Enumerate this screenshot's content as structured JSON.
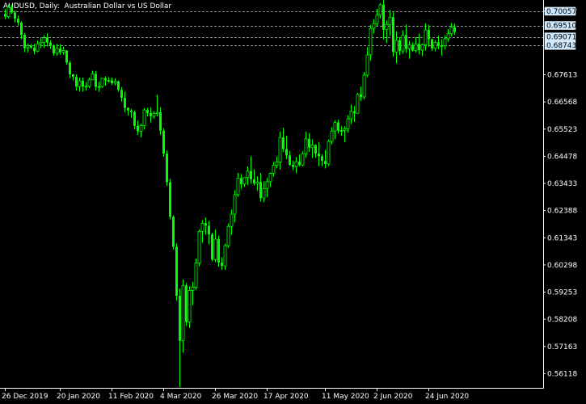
{
  "chart_data": {
    "type": "candlestick",
    "symbol": "AUDUSD",
    "timeframe": "Daily",
    "description": "Australian Dollar vs US Dollar",
    "title_sep": ", ",
    "title_sep2": ":  ",
    "ylim": [
      0.5557,
      0.7049
    ],
    "y_ticks": [
      "0.70057",
      "0.67613",
      "0.66568",
      "0.65523",
      "0.64478",
      "0.63433",
      "0.62388",
      "0.61343",
      "0.60298",
      "0.59253",
      "0.58208",
      "0.57163",
      "0.56118"
    ],
    "y_tick_values": [
      0.70057,
      0.67613,
      0.66568,
      0.65523,
      0.64478,
      0.63433,
      0.62388,
      0.61343,
      0.60298,
      0.59253,
      0.58208,
      0.57163,
      0.56118
    ],
    "highlight_labels": [
      "0.70057",
      "0.69510",
      "0.69071",
      "0.68743"
    ],
    "highlight_values": [
      0.70057,
      0.6951,
      0.69071,
      0.68743
    ],
    "x_ticks": [
      "26 Dec 2019",
      "20 Jan 2020",
      "11 Feb 2020",
      "4 Mar 2020",
      "26 Mar 2020",
      "17 Apr 2020",
      "11 May 2020",
      "2 Jun 2020",
      "24 Jun 2020"
    ],
    "x_tick_bar_index": [
      0,
      17,
      33,
      49,
      65,
      81,
      99,
      115,
      131
    ],
    "candles": [
      [
        0.6995,
        0.7015,
        0.6975,
        0.6985
      ],
      [
        0.6985,
        0.7032,
        0.6978,
        0.7021
      ],
      [
        0.7021,
        0.7031,
        0.6996,
        0.7001
      ],
      [
        0.7001,
        0.7009,
        0.6964,
        0.6977
      ],
      [
        0.6977,
        0.6989,
        0.6951,
        0.6962
      ],
      [
        0.6962,
        0.6967,
        0.6898,
        0.6915
      ],
      [
        0.6915,
        0.6922,
        0.6848,
        0.6864
      ],
      [
        0.6864,
        0.6882,
        0.6847,
        0.6872
      ],
      [
        0.6872,
        0.6879,
        0.6861,
        0.6866
      ],
      [
        0.6866,
        0.688,
        0.684,
        0.6852
      ],
      [
        0.6852,
        0.6893,
        0.6848,
        0.688
      ],
      [
        0.688,
        0.6902,
        0.6864,
        0.6886
      ],
      [
        0.6886,
        0.6913,
        0.6865,
        0.6904
      ],
      [
        0.6904,
        0.6921,
        0.687,
        0.6885
      ],
      [
        0.6885,
        0.6894,
        0.6861,
        0.6873
      ],
      [
        0.6873,
        0.6877,
        0.6834,
        0.6844
      ],
      [
        0.6844,
        0.688,
        0.6835,
        0.6863
      ],
      [
        0.6863,
        0.6879,
        0.6838,
        0.6848
      ],
      [
        0.6848,
        0.687,
        0.6838,
        0.6855
      ],
      [
        0.6855,
        0.6856,
        0.68,
        0.6808
      ],
      [
        0.6808,
        0.6815,
        0.6748,
        0.6763
      ],
      [
        0.6763,
        0.6765,
        0.674,
        0.6753
      ],
      [
        0.6753,
        0.6763,
        0.6701,
        0.6716
      ],
      [
        0.6716,
        0.6751,
        0.6697,
        0.6738
      ],
      [
        0.6738,
        0.6751,
        0.6697,
        0.6716
      ],
      [
        0.6716,
        0.6733,
        0.67,
        0.6717
      ],
      [
        0.6717,
        0.675,
        0.671,
        0.6742
      ],
      [
        0.6742,
        0.6777,
        0.6741,
        0.6765
      ],
      [
        0.6765,
        0.6776,
        0.6702,
        0.6715
      ],
      [
        0.6715,
        0.6735,
        0.6696,
        0.6716
      ],
      [
        0.6716,
        0.6748,
        0.6711,
        0.6748
      ],
      [
        0.6748,
        0.6755,
        0.6719,
        0.674
      ],
      [
        0.674,
        0.6752,
        0.6731,
        0.674
      ],
      [
        0.674,
        0.6751,
        0.6723,
        0.6729
      ],
      [
        0.6729,
        0.6748,
        0.672,
        0.6736
      ],
      [
        0.6736,
        0.6739,
        0.6697,
        0.6703
      ],
      [
        0.6703,
        0.6714,
        0.6659,
        0.6673
      ],
      [
        0.6673,
        0.6697,
        0.6618,
        0.6634
      ],
      [
        0.6634,
        0.6636,
        0.6604,
        0.6624
      ],
      [
        0.6624,
        0.663,
        0.6596,
        0.6618
      ],
      [
        0.6618,
        0.6623,
        0.6553,
        0.6565
      ],
      [
        0.6565,
        0.6585,
        0.653,
        0.6544
      ],
      [
        0.6544,
        0.6573,
        0.6521,
        0.6566
      ],
      [
        0.6566,
        0.6634,
        0.6551,
        0.6626
      ],
      [
        0.6626,
        0.6634,
        0.6601,
        0.6614
      ],
      [
        0.6614,
        0.6636,
        0.6578,
        0.6602
      ],
      [
        0.6602,
        0.6621,
        0.6593,
        0.6612
      ],
      [
        0.6612,
        0.6685,
        0.6601,
        0.6617
      ],
      [
        0.6617,
        0.6636,
        0.6531,
        0.6546
      ],
      [
        0.6546,
        0.6555,
        0.6446,
        0.6458
      ],
      [
        0.6458,
        0.647,
        0.6334,
        0.6348
      ],
      [
        0.6348,
        0.6361,
        0.6205,
        0.6215
      ],
      [
        0.6215,
        0.622,
        0.6089,
        0.61
      ],
      [
        0.61,
        0.6113,
        0.5892,
        0.5911
      ],
      [
        0.5911,
        0.5939,
        0.556,
        0.5738
      ],
      [
        0.5738,
        0.5974,
        0.5692,
        0.5951
      ],
      [
        0.5951,
        0.596,
        0.5796,
        0.581
      ],
      [
        0.581,
        0.5948,
        0.5787,
        0.5932
      ],
      [
        0.5932,
        0.5964,
        0.5875,
        0.5944
      ],
      [
        0.5944,
        0.6054,
        0.5934,
        0.6037
      ],
      [
        0.6037,
        0.6166,
        0.6024,
        0.6159
      ],
      [
        0.6159,
        0.6202,
        0.6115,
        0.619
      ],
      [
        0.619,
        0.6212,
        0.6146,
        0.6181
      ],
      [
        0.6181,
        0.6199,
        0.6109,
        0.6147
      ],
      [
        0.6147,
        0.6154,
        0.6044,
        0.605
      ],
      [
        0.605,
        0.6167,
        0.604,
        0.6129
      ],
      [
        0.6129,
        0.6143,
        0.6023,
        0.6039
      ],
      [
        0.6039,
        0.6059,
        0.6011,
        0.6026
      ],
      [
        0.6026,
        0.6112,
        0.6011,
        0.6104
      ],
      [
        0.6104,
        0.6189,
        0.6095,
        0.6178
      ],
      [
        0.6178,
        0.6243,
        0.6146,
        0.6225
      ],
      [
        0.6225,
        0.6317,
        0.6194,
        0.63
      ],
      [
        0.63,
        0.6384,
        0.6292,
        0.6364
      ],
      [
        0.6364,
        0.6379,
        0.6324,
        0.6341
      ],
      [
        0.6341,
        0.6367,
        0.633,
        0.6366
      ],
      [
        0.6366,
        0.6409,
        0.6337,
        0.6391
      ],
      [
        0.6391,
        0.6448,
        0.6342,
        0.6359
      ],
      [
        0.6359,
        0.6398,
        0.6336,
        0.6343
      ],
      [
        0.6343,
        0.6371,
        0.6316,
        0.6349
      ],
      [
        0.6349,
        0.6383,
        0.6274,
        0.6287
      ],
      [
        0.6287,
        0.6351,
        0.6271,
        0.6324
      ],
      [
        0.6324,
        0.6364,
        0.629,
        0.635
      ],
      [
        0.635,
        0.6386,
        0.633,
        0.6382
      ],
      [
        0.6382,
        0.6426,
        0.637,
        0.6413
      ],
      [
        0.6413,
        0.6447,
        0.6402,
        0.6426
      ],
      [
        0.6426,
        0.6543,
        0.6397,
        0.652
      ],
      [
        0.652,
        0.6557,
        0.6464,
        0.6476
      ],
      [
        0.6476,
        0.6527,
        0.6437,
        0.6451
      ],
      [
        0.6451,
        0.6468,
        0.6411,
        0.6415
      ],
      [
        0.6415,
        0.6431,
        0.6394,
        0.6407
      ],
      [
        0.6407,
        0.6445,
        0.6382,
        0.6427
      ],
      [
        0.6427,
        0.6454,
        0.6409,
        0.6414
      ],
      [
        0.6414,
        0.6467,
        0.6409,
        0.6458
      ],
      [
        0.6458,
        0.6543,
        0.6443,
        0.6515
      ],
      [
        0.6515,
        0.6537,
        0.6465,
        0.6481
      ],
      [
        0.6481,
        0.6513,
        0.6441,
        0.6491
      ],
      [
        0.6491,
        0.6494,
        0.6442,
        0.6458
      ],
      [
        0.6458,
        0.6501,
        0.641,
        0.6448
      ],
      [
        0.6448,
        0.6456,
        0.6409,
        0.643
      ],
      [
        0.643,
        0.6472,
        0.6401,
        0.6418
      ],
      [
        0.6418,
        0.6512,
        0.6409,
        0.6505
      ],
      [
        0.6505,
        0.6559,
        0.6494,
        0.6545
      ],
      [
        0.6545,
        0.6587,
        0.6514,
        0.6578
      ],
      [
        0.6578,
        0.6588,
        0.6535,
        0.6546
      ],
      [
        0.6546,
        0.6565,
        0.6526,
        0.6547
      ],
      [
        0.6547,
        0.6563,
        0.6501,
        0.6554
      ],
      [
        0.6554,
        0.6605,
        0.6539,
        0.6592
      ],
      [
        0.6592,
        0.6647,
        0.6573,
        0.6621
      ],
      [
        0.6621,
        0.6641,
        0.658,
        0.6613
      ],
      [
        0.6613,
        0.6692,
        0.6611,
        0.6686
      ],
      [
        0.6686,
        0.6716,
        0.6661,
        0.6676
      ],
      [
        0.6676,
        0.6772,
        0.6667,
        0.676
      ],
      [
        0.676,
        0.6867,
        0.6752,
        0.6838
      ],
      [
        0.6838,
        0.6953,
        0.6816,
        0.694
      ],
      [
        0.694,
        0.6976,
        0.692,
        0.6958
      ],
      [
        0.6958,
        0.7015,
        0.6949,
        0.6991
      ],
      [
        0.6991,
        0.7037,
        0.6978,
        0.7031
      ],
      [
        0.7031,
        0.7064,
        0.6897,
        0.6935
      ],
      [
        0.6935,
        0.6971,
        0.6883,
        0.6955
      ],
      [
        0.6955,
        0.7011,
        0.6911,
        0.6983
      ],
      [
        0.6983,
        0.7002,
        0.6831,
        0.6849
      ],
      [
        0.6849,
        0.6928,
        0.6805,
        0.6894
      ],
      [
        0.6894,
        0.6906,
        0.6837,
        0.6853
      ],
      [
        0.6853,
        0.6932,
        0.6842,
        0.6914
      ],
      [
        0.6914,
        0.6955,
        0.6846,
        0.6861
      ],
      [
        0.6861,
        0.6892,
        0.6823,
        0.6876
      ],
      [
        0.6876,
        0.6886,
        0.685,
        0.6855
      ],
      [
        0.6855,
        0.6906,
        0.6847,
        0.688
      ],
      [
        0.688,
        0.692,
        0.684,
        0.6856
      ],
      [
        0.6856,
        0.6882,
        0.6833,
        0.6877
      ],
      [
        0.6877,
        0.6959,
        0.6855,
        0.6934
      ],
      [
        0.6934,
        0.6953,
        0.6869,
        0.6898
      ],
      [
        0.6898,
        0.6901,
        0.6853,
        0.6863
      ],
      [
        0.6863,
        0.6894,
        0.6852,
        0.6886
      ],
      [
        0.6886,
        0.6912,
        0.686,
        0.6873
      ],
      [
        0.6873,
        0.6897,
        0.6835,
        0.6873
      ],
      [
        0.6873,
        0.6913,
        0.6859,
        0.69
      ],
      [
        0.69,
        0.6937,
        0.6888,
        0.6919
      ],
      [
        0.6919,
        0.696,
        0.6909,
        0.6944
      ],
      [
        0.6944,
        0.6958,
        0.6915,
        0.6926
      ]
    ],
    "grid": false,
    "background": "#000000",
    "candle_color": "#00ff00",
    "text_color": "#ffffff",
    "hline_color": "#c0c0c0",
    "label_bg": "#cce8ff"
  }
}
